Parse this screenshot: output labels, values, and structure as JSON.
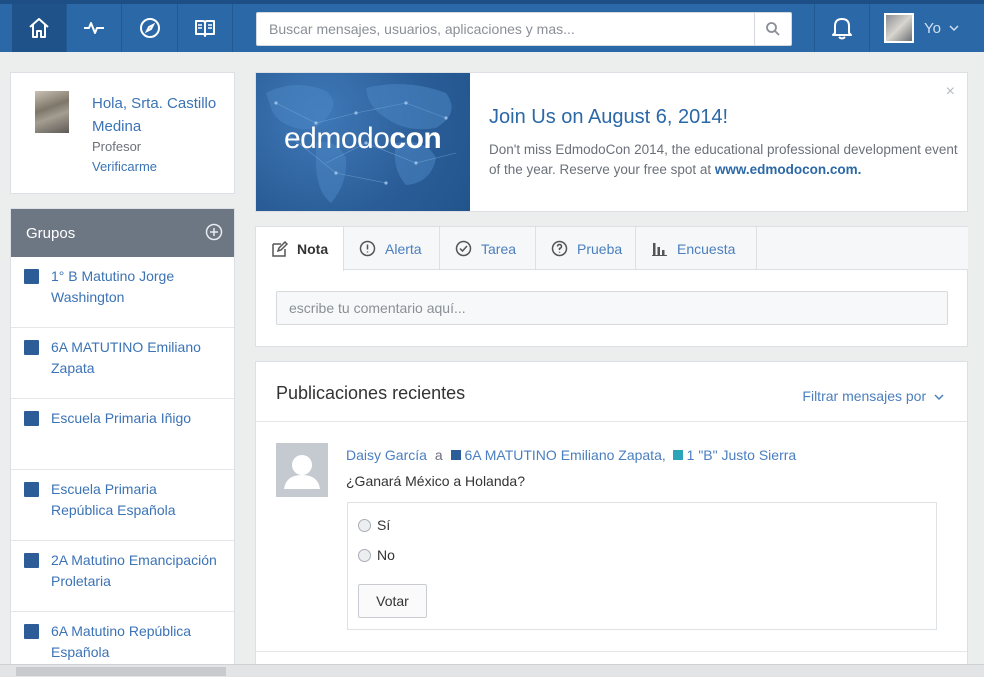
{
  "nav": {
    "items": [
      {
        "name": "home-icon",
        "active": true
      },
      {
        "name": "activity-icon",
        "active": false
      },
      {
        "name": "compass-icon",
        "active": false
      },
      {
        "name": "book-icon",
        "active": false
      }
    ],
    "search_placeholder": "Buscar mensajes, usuarios, aplicaciones y mas...",
    "user_label": "Yo"
  },
  "profile": {
    "greeting": "Hola, Srta. Castillo Medina",
    "role": "Profesor",
    "verify_link": "Verificarme"
  },
  "groups": {
    "title": "Grupos",
    "items": [
      {
        "label": "1° B Matutino Jorge Washington"
      },
      {
        "label": "6A MATUTINO Emiliano Zapata"
      },
      {
        "label": "Escuela Primaria Iñigo"
      },
      {
        "label": "Escuela Primaria República Española"
      },
      {
        "label": "2A Matutino Emancipación Proletaria"
      },
      {
        "label": "6A Matutino República Española"
      }
    ]
  },
  "banner": {
    "logo_light": "edmodo",
    "logo_bold": "con",
    "title": "Join Us on August 6, 2014!",
    "text": "Don't miss EdmodoCon 2014, the educational professional development event of the year. Reserve your free spot at ",
    "link": "www.edmodocon.com.",
    "close": "×"
  },
  "composer": {
    "tabs": [
      {
        "label": "Nota"
      },
      {
        "label": "Alerta"
      },
      {
        "label": "Tarea"
      },
      {
        "label": "Prueba"
      },
      {
        "label": "Encuesta"
      }
    ],
    "placeholder": "escribe tu comentario aquí..."
  },
  "feed": {
    "title": "Publicaciones recientes",
    "filter": "Filtrar mensajes por",
    "post": {
      "author": "Daisy García",
      "connector": "a",
      "group1": "6A MATUTINO Emiliano Zapata,",
      "group2": "1 \"B\" Justo Sierra",
      "question": "¿Ganará México a Holanda?",
      "options": [
        "Sí",
        "No"
      ],
      "vote_label": "Votar"
    }
  },
  "colors": {
    "topbar": "#2b68a7",
    "link": "#3b73b5",
    "group_square": "#2c5d98",
    "teal": "#2ba3b9"
  }
}
